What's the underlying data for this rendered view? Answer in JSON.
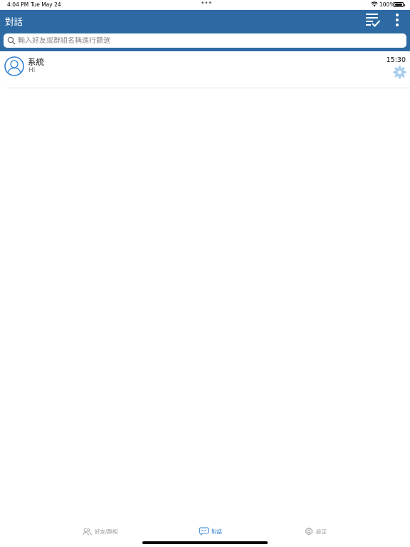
{
  "status_bar": {
    "time": "4:04 PM",
    "date": "Tue May 24",
    "dots": "•••",
    "battery": "100%"
  },
  "header": {
    "title": "對話",
    "select_icon": "checklist-icon",
    "more_icon": "more-vertical-icon"
  },
  "search": {
    "placeholder": "輸入好友或群組名稱進行篩選",
    "value": ""
  },
  "conversations": [
    {
      "name": "系統",
      "message": "Hi",
      "time": "15:30",
      "avatar_icon": "user-avatar-icon",
      "settings_icon": "gear-icon"
    }
  ],
  "tabs": [
    {
      "label": "好友/群組",
      "icon": "contacts-icon",
      "active": false
    },
    {
      "label": "對話",
      "icon": "chat-icon",
      "active": true
    },
    {
      "label": "設定",
      "icon": "settings-icon",
      "active": false
    }
  ],
  "colors": {
    "header_bg": "#2d6aa3",
    "accent": "#2f80d1",
    "inactive": "#9a9a9a"
  }
}
